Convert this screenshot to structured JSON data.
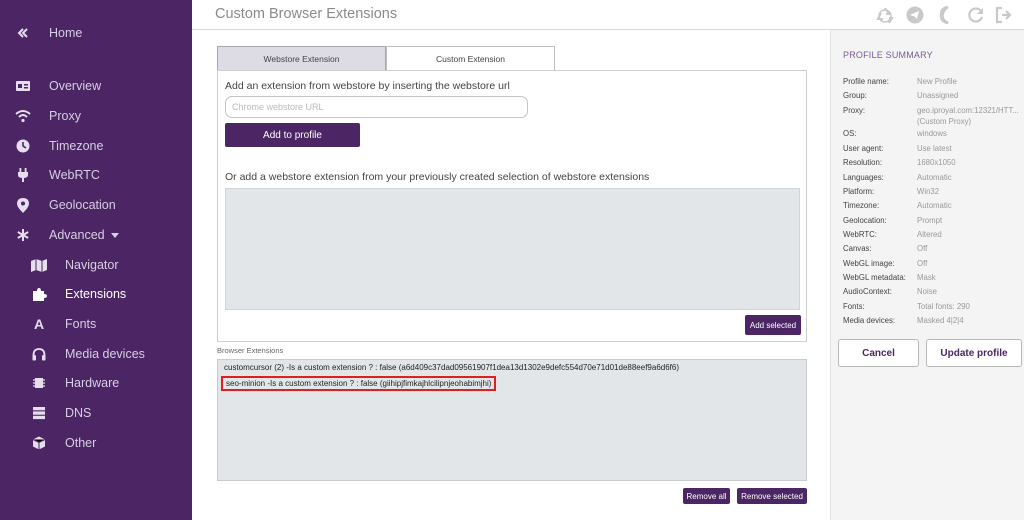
{
  "header": {
    "title": "Custom Browser Extensions",
    "icons": [
      "recycle-icon",
      "telegram-icon",
      "moon-icon",
      "refresh-icon",
      "logout-icon"
    ]
  },
  "sidebar": {
    "items": [
      {
        "label": "Home",
        "icon": "double-chevron-left-icon"
      },
      {
        "label": "Overview",
        "icon": "id-card-icon"
      },
      {
        "label": "Proxy",
        "icon": "wifi-icon"
      },
      {
        "label": "Timezone",
        "icon": "clock-icon"
      },
      {
        "label": "WebRTC",
        "icon": "plug-icon"
      },
      {
        "label": "Geolocation",
        "icon": "map-marker-icon"
      },
      {
        "label": "Advanced",
        "icon": "asterisk-icon"
      },
      {
        "label": "Navigator",
        "icon": "map-icon"
      },
      {
        "label": "Extensions",
        "icon": "puzzle-icon"
      },
      {
        "label": "Fonts",
        "icon": "font-icon"
      },
      {
        "label": "Media devices",
        "icon": "headphones-icon"
      },
      {
        "label": "Hardware",
        "icon": "chip-icon"
      },
      {
        "label": "DNS",
        "icon": "server-icon"
      },
      {
        "label": "Other",
        "icon": "cube-icon"
      }
    ]
  },
  "tabs": [
    {
      "label": "Webstore Extension",
      "active": true
    },
    {
      "label": "Custom Extension",
      "active": false
    }
  ],
  "webstore": {
    "heading": "Add an extension from webstore by inserting the webstore url",
    "url_placeholder": "Chrome webstore URL",
    "add_button": "Add to profile",
    "selection_heading": "Or add a webstore extension from your previously created selection of webstore extensions",
    "add_selected_button": "Add selected"
  },
  "browser_extensions": {
    "label": "Browser Extensions",
    "items": [
      "customcursor (2) -Is a custom extension ? : false (a6d409c37dad09561907f1dea13d1302e9defc554d70e71d01de88eef9a6d6f6)",
      "seo-minion -Is a custom extension ? : false (giihipjfimkajhlcilipnjeohabimjhi)"
    ],
    "remove_all_button": "Remove all",
    "remove_selected_button": "Remove selected"
  },
  "profile_summary": {
    "title": "PROFILE SUMMARY",
    "rows": [
      {
        "key": "Profile name:",
        "value": "New Profile"
      },
      {
        "key": "Group:",
        "value": "Unassigned"
      },
      {
        "key": "Proxy:",
        "value": "geo.iproyal.com:12321/HTT... (Custom Proxy)"
      },
      {
        "key": "OS:",
        "value": "windows"
      },
      {
        "key": "User agent:",
        "value": "Use latest"
      },
      {
        "key": "Resolution:",
        "value": "1680x1050"
      },
      {
        "key": "Languages:",
        "value": "Automatic"
      },
      {
        "key": "Platform:",
        "value": "Win32"
      },
      {
        "key": "Timezone:",
        "value": "Automatic"
      },
      {
        "key": "Geolocation:",
        "value": "Prompt"
      },
      {
        "key": "WebRTC:",
        "value": "Altered"
      },
      {
        "key": "Canvas:",
        "value": "Off"
      },
      {
        "key": "WebGL image:",
        "value": "Off"
      },
      {
        "key": "WebGL metadata:",
        "value": "Mask"
      },
      {
        "key": "AudioContext:",
        "value": "Noise"
      },
      {
        "key": "Fonts:",
        "value": "Total fonts: 290"
      },
      {
        "key": "Media devices:",
        "value": "Masked 4|2|4"
      }
    ],
    "cancel_button": "Cancel",
    "update_button": "Update profile"
  },
  "colors": {
    "sidebar_bg": "#4b2564",
    "accent": "#4b2564",
    "highlight_border": "#e0201f"
  }
}
